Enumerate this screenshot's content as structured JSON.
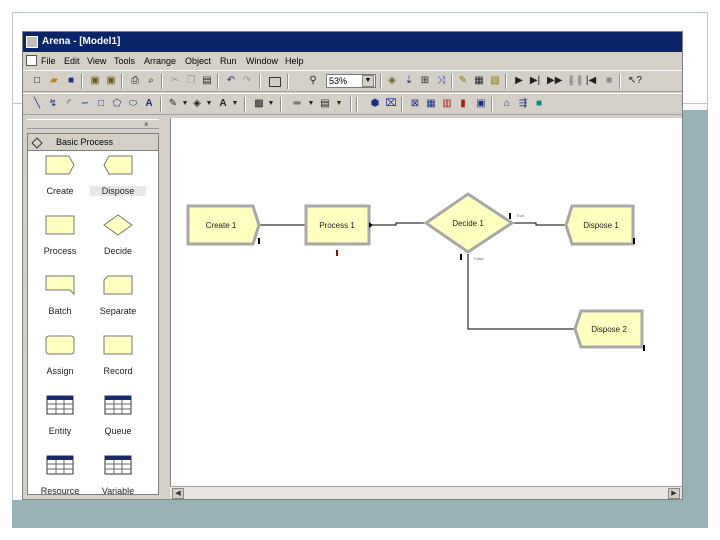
{
  "window": {
    "title": "Arena - [Model1]"
  },
  "menu": [
    "File",
    "Edit",
    "View",
    "Tools",
    "Arrange",
    "Object",
    "Run",
    "Window",
    "Help"
  ],
  "toolbar": {
    "zoom_value": "53%"
  },
  "panel": {
    "title": "Basic Process",
    "modules": [
      {
        "label": "Create",
        "icon": "create-module-icon"
      },
      {
        "label": "Dispose",
        "icon": "dispose-module-icon"
      },
      {
        "label": "Process",
        "icon": "process-module-icon"
      },
      {
        "label": "Decide",
        "icon": "decide-module-icon"
      },
      {
        "label": "Batch",
        "icon": "batch-module-icon"
      },
      {
        "label": "Separate",
        "icon": "separate-module-icon"
      },
      {
        "label": "Assign",
        "icon": "assign-module-icon"
      },
      {
        "label": "Record",
        "icon": "record-module-icon"
      },
      {
        "label": "Entity",
        "icon": "spreadsheet-icon"
      },
      {
        "label": "Queue",
        "icon": "spreadsheet-icon"
      },
      {
        "label": "Resource",
        "icon": "spreadsheet-icon"
      },
      {
        "label": "Variable",
        "icon": "spreadsheet-icon"
      }
    ]
  },
  "model": {
    "create": "Create 1",
    "process": "Process 1",
    "decide": "Decide 1",
    "dispose1": "Dispose 1",
    "dispose2": "Dispose 2",
    "true_label": "True",
    "false_label": "False"
  },
  "colors": {
    "module_fill": "#ffffc0",
    "module_border": "#a8a8a8",
    "connector": "#000000",
    "titlebar": "#0a246a"
  }
}
